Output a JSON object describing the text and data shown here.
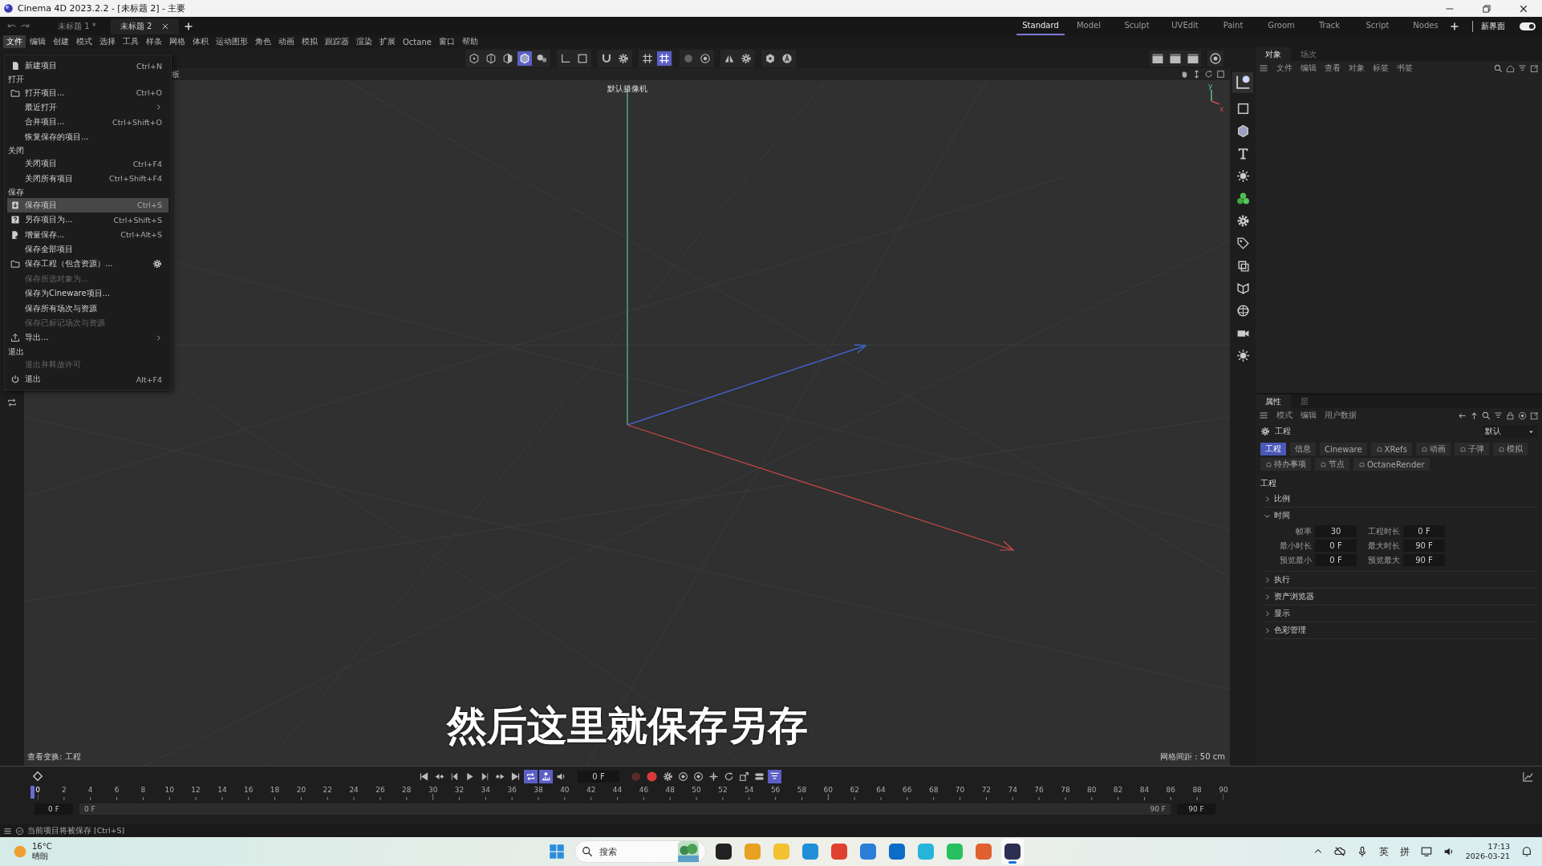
{
  "window": {
    "title": "Cinema 4D 2023.2.2 - [未标题 2] - 主要"
  },
  "doc_tabs": [
    {
      "label": "未标题 1 *",
      "selected": false
    },
    {
      "label": "未标题 2",
      "selected": true
    }
  ],
  "layouts": [
    {
      "label": "Standard",
      "selected": true
    },
    {
      "label": "Model",
      "selected": false
    },
    {
      "label": "Sculpt",
      "selected": false
    },
    {
      "label": "UVEdit",
      "selected": false
    },
    {
      "label": "Paint",
      "selected": false
    },
    {
      "label": "Groom",
      "selected": false
    },
    {
      "label": "Track",
      "selected": false
    },
    {
      "label": "Script",
      "selected": false
    },
    {
      "label": "Nodes",
      "selected": false
    }
  ],
  "layout_switch": {
    "label": "新界面",
    "on": true
  },
  "menu_bar": [
    {
      "label": "文件",
      "selected": true
    },
    {
      "label": "编辑",
      "selected": false
    },
    {
      "label": "创建",
      "selected": false
    },
    {
      "label": "模式",
      "selected": false
    },
    {
      "label": "选择",
      "selected": false
    },
    {
      "label": "工具",
      "selected": false
    },
    {
      "label": "样条",
      "selected": false
    },
    {
      "label": "网格",
      "selected": false
    },
    {
      "label": "体积",
      "selected": false
    },
    {
      "label": "运动图形",
      "selected": false
    },
    {
      "label": "角色",
      "selected": false
    },
    {
      "label": "动画",
      "selected": false
    },
    {
      "label": "模拟",
      "selected": false
    },
    {
      "label": "跟踪器",
      "selected": false
    },
    {
      "label": "渲染",
      "selected": false
    },
    {
      "label": "扩展",
      "selected": false
    },
    {
      "label": "Octane",
      "selected": false
    },
    {
      "label": "窗口",
      "selected": false
    },
    {
      "label": "帮助",
      "selected": false
    }
  ],
  "toolbar": [
    [
      {
        "selected": false
      },
      {
        "selected": false
      },
      {
        "selected": false
      },
      {
        "selected": true
      },
      {
        "selected": false
      }
    ],
    [
      {
        "selected": false
      },
      {
        "selected": false
      }
    ],
    [
      {
        "selected": false
      },
      {
        "selected": false
      }
    ],
    [
      {
        "selected": false
      },
      {
        "selected": true
      }
    ],
    [
      {
        "selected": false
      },
      {
        "selected": false
      }
    ],
    [
      {
        "selected": false
      },
      {
        "selected": false
      }
    ],
    [
      {
        "selected": false
      },
      {
        "selected": false
      }
    ]
  ],
  "viewport": {
    "menu_tail": "板",
    "camera": "默认摄像机",
    "gizmo_labels": [
      "y",
      "x"
    ],
    "view_transform": "查看变换: 工程",
    "grid_spacing": "网格间距 : 50 cm"
  },
  "subtitle": "然后这里就保存另存",
  "file_menu": [
    {
      "kind": "item",
      "label": "新建项目",
      "shortcut": "Ctrl+N",
      "disabled": false,
      "selected": false
    },
    {
      "kind": "header",
      "label": "打开"
    },
    {
      "kind": "item",
      "label": "打开项目...",
      "shortcut": "Ctrl+O",
      "disabled": false,
      "selected": false
    },
    {
      "kind": "submenu",
      "label": "最近打开",
      "disabled": false,
      "selected": false
    },
    {
      "kind": "item",
      "label": "合并项目...",
      "shortcut": "Ctrl+Shift+O",
      "disabled": false,
      "selected": false
    },
    {
      "kind": "item",
      "label": "恢复保存的项目...",
      "disabled": false,
      "selected": false
    },
    {
      "kind": "header",
      "label": "关闭"
    },
    {
      "kind": "item",
      "label": "关闭项目",
      "shortcut": "Ctrl+F4",
      "disabled": false,
      "selected": false
    },
    {
      "kind": "item",
      "label": "关闭所有项目",
      "shortcut": "Ctrl+Shift+F4",
      "disabled": false,
      "selected": false
    },
    {
      "kind": "header",
      "label": "保存"
    },
    {
      "kind": "item",
      "label": "保存项目",
      "shortcut": "Ctrl+S",
      "disabled": false,
      "selected": true
    },
    {
      "kind": "item",
      "label": "另存项目为...",
      "shortcut": "Ctrl+Shift+S",
      "disabled": false,
      "selected": false
    },
    {
      "kind": "item",
      "label": "增量保存...",
      "shortcut": "Ctrl+Alt+S",
      "disabled": false,
      "selected": false
    },
    {
      "kind": "item",
      "label": "保存全部项目",
      "disabled": false,
      "selected": false
    },
    {
      "kind": "item",
      "label": "保存工程（包含资源）...",
      "disabled": false,
      "selected": false
    },
    {
      "kind": "item",
      "label": "保存所选对象为...",
      "disabled": true,
      "selected": false
    },
    {
      "kind": "item",
      "label": "保存为Cineware项目...",
      "disabled": false,
      "selected": false
    },
    {
      "kind": "item",
      "label": "保存所有场次与资源",
      "disabled": false,
      "selected": false
    },
    {
      "kind": "item",
      "label": "保存已标记场次与资源",
      "disabled": true,
      "selected": false
    },
    {
      "kind": "submenu",
      "label": "导出...",
      "disabled": false,
      "selected": false
    },
    {
      "kind": "header",
      "label": "退出"
    },
    {
      "kind": "item",
      "label": "退出并释放许可",
      "disabled": true,
      "selected": false
    },
    {
      "kind": "item",
      "label": "退出",
      "shortcut": "Alt+F4",
      "disabled": false,
      "selected": false
    }
  ],
  "objects_panel": {
    "tabs": [
      {
        "label": "对象",
        "selected": true
      },
      {
        "label": "场次",
        "selected": false
      }
    ],
    "menu": [
      "文件",
      "编辑",
      "查看",
      "对象",
      "标签",
      "书签"
    ]
  },
  "attributes_panel": {
    "tabs": [
      {
        "label": "属性",
        "selected": true
      },
      {
        "label": "层",
        "selected": false
      }
    ],
    "menu": [
      "模式",
      "编辑",
      "用户数据"
    ],
    "object": "工程",
    "preset": "默认",
    "pages": [
      {
        "label": "工程",
        "selected": true,
        "marked": false
      },
      {
        "label": "信息",
        "selected": false,
        "marked": false
      },
      {
        "label": "Cineware",
        "selected": false,
        "marked": false
      },
      {
        "label": "XRefs",
        "selected": false,
        "marked": true
      },
      {
        "label": "动画",
        "selected": false,
        "marked": true
      },
      {
        "label": "子弹",
        "selected": false,
        "marked": true
      },
      {
        "label": "模拟",
        "selected": false,
        "marked": true
      },
      {
        "label": "待办事项",
        "selected": false,
        "marked": true
      },
      {
        "label": "节点",
        "selected": false,
        "marked": true
      },
      {
        "label": "OctaneRender",
        "selected": false,
        "marked": true
      }
    ],
    "section": "工程",
    "groups": [
      {
        "label": "比例",
        "expanded": false
      },
      {
        "label": "时间",
        "expanded": true,
        "fields": [
          {
            "label": "帧率",
            "value": "30"
          },
          {
            "label": "工程时长",
            "value": "0 F"
          },
          {
            "label": "最小时长",
            "value": "0 F"
          },
          {
            "label": "最大时长",
            "value": "90 F"
          },
          {
            "label": "预览最小",
            "value": "0 F"
          },
          {
            "label": "预览最大",
            "value": "90 F"
          }
        ]
      },
      {
        "label": "执行",
        "expanded": false
      },
      {
        "label": "资产浏览器",
        "expanded": false
      },
      {
        "label": "显示",
        "expanded": false
      },
      {
        "label": "色彩管理",
        "expanded": false
      }
    ]
  },
  "timeline": {
    "buttons": [
      {
        "selected": false
      },
      {
        "selected": false
      },
      {
        "selected": false
      },
      {
        "selected": false
      },
      {
        "selected": false
      },
      {
        "selected": false
      },
      {
        "selected": false
      },
      {
        "selected": true
      },
      {
        "selected": true
      },
      {
        "selected": false
      }
    ],
    "current_frame": "0 F",
    "key_buttons": [
      {
        "selected": false
      },
      {
        "selected": false
      },
      {
        "selected": false
      },
      {
        "selected": false
      },
      {
        "selected": false
      },
      {
        "selected": false
      },
      {
        "selected": false
      },
      {
        "selected": false
      },
      {
        "selected": false
      },
      {
        "selected": true
      }
    ],
    "ruler": [
      "0",
      "2",
      "4",
      "6",
      "8",
      "10",
      "12",
      "14",
      "16",
      "18",
      "20",
      "22",
      "24",
      "26",
      "28",
      "30",
      "32",
      "34",
      "36",
      "38",
      "40",
      "42",
      "44",
      "46",
      "48",
      "50",
      "52",
      "54",
      "56",
      "58",
      "60",
      "62",
      "64",
      "66",
      "68",
      "70",
      "72",
      "74",
      "76",
      "78",
      "80",
      "82",
      "84",
      "86",
      "88",
      "90"
    ],
    "range": {
      "start": "0 F",
      "min": "0 F",
      "max": "90 F",
      "end": "90 F",
      "level": 1
    }
  },
  "status_bar": "当前项目将被保存 [Ctrl+S]",
  "taskbar": {
    "temperature": "16°C",
    "weather": "晴朗",
    "search_placeholder": "搜索",
    "apps": [
      {
        "selected": false
      },
      {
        "selected": false
      },
      {
        "selected": false
      },
      {
        "selected": false
      },
      {
        "selected": false
      },
      {
        "selected": false
      },
      {
        "selected": false
      },
      {
        "selected": false
      },
      {
        "selected": false
      },
      {
        "selected": false
      },
      {
        "selected": true
      }
    ],
    "input_modes": [
      "英",
      "拼"
    ],
    "time": "17:13",
    "date": "2026-03-21"
  }
}
